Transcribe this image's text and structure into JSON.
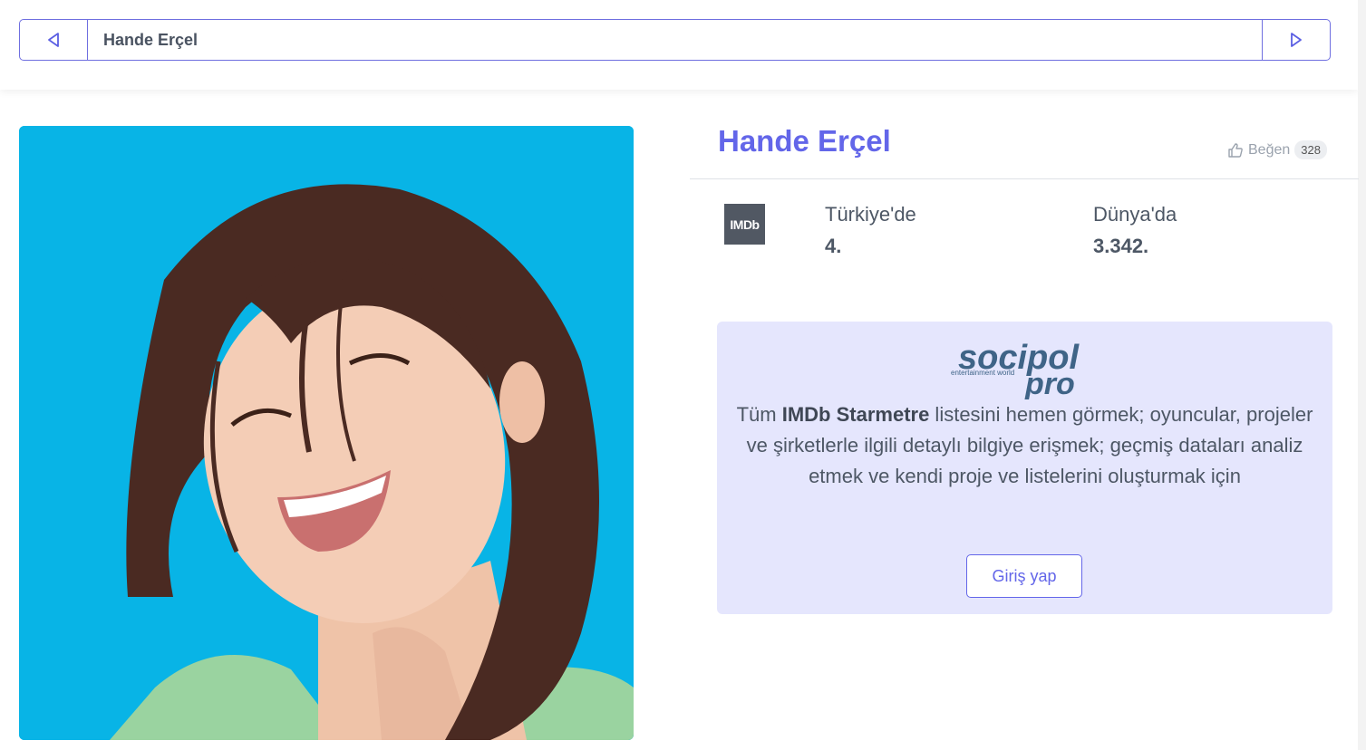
{
  "nav": {
    "title": "Hande Erçel",
    "prev_icon": "triangle-left-icon",
    "next_icon": "triangle-right-icon"
  },
  "profile": {
    "name": "Hande Erçel",
    "like_label": "Beğen",
    "like_count": "328",
    "photo_alt": "Hande Erçel"
  },
  "ranks": {
    "imdb_badge": "IMDb",
    "turkey_label": "Türkiye'de",
    "turkey_value": "4.",
    "world_label": "Dünya'da",
    "world_value": "3.342."
  },
  "promo": {
    "logo_main": "socipol",
    "logo_sub": "pro",
    "logo_tagline": "entertainment world",
    "text_before": "Tüm ",
    "text_bold": "IMDb Starmetre",
    "text_after": " listesini hemen görmek; oyuncular, projeler ve şirketlerle ilgili detaylı bilgiye erişmek; geçmiş dataları analiz etmek ve kendi proje ve listelerini oluşturmak için",
    "login_label": "Giriş yap"
  },
  "colors": {
    "accent": "#6366e9",
    "photo_bg": "#08b4e6",
    "promo_bg": "#e5e6fd"
  }
}
